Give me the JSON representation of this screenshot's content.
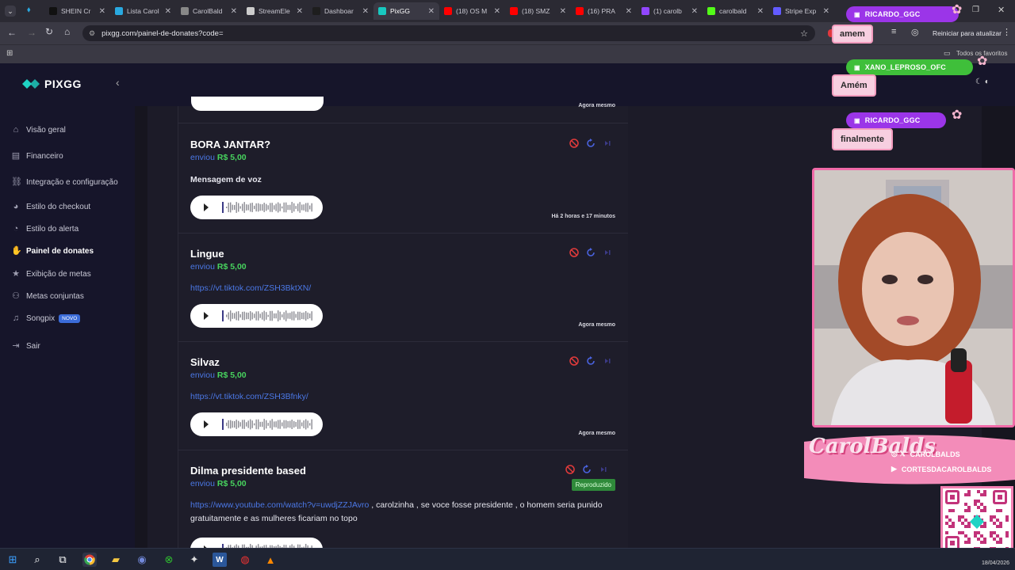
{
  "browser": {
    "tabs": [
      {
        "label": "SHEIN Cr",
        "color": "#111111"
      },
      {
        "label": "Lista Carol",
        "color": "#29a9e0"
      },
      {
        "label": "CarolBald",
        "color": "#888888"
      },
      {
        "label": "StreamEle",
        "color": "#cccccc"
      },
      {
        "label": "Dashboar",
        "color": "#1e1e1e"
      },
      {
        "label": "PixGG",
        "color": "#18c8c0"
      },
      {
        "label": "(18) OS M",
        "color": "#ff0000"
      },
      {
        "label": "(18) SMZ",
        "color": "#ff0000"
      },
      {
        "label": "(16) PRA",
        "color": "#ff0000"
      },
      {
        "label": "(1) carolb",
        "color": "#9146ff"
      },
      {
        "label": "carolbald",
        "color": "#53fc18"
      },
      {
        "label": "Stripe Exp",
        "color": "#635bff"
      }
    ],
    "url": "pixgg.com/painel-de-donates?code=",
    "reload_label": "Reiniciar para atualizar",
    "favorites_label": "Todos os favoritos"
  },
  "app": {
    "logo": "PIXGG",
    "nav": [
      {
        "label": "Visão geral",
        "icon": "home-icon"
      },
      {
        "label": "Financeiro",
        "icon": "wallet-icon"
      },
      {
        "label": "Integração e configuração",
        "icon": "link-icon"
      },
      {
        "label": "Estilo do checkout",
        "icon": "palette-icon"
      },
      {
        "label": "Estilo do alerta",
        "icon": "bell-icon"
      },
      {
        "label": "Painel de donates",
        "icon": "hand-coins-icon"
      },
      {
        "label": "Exibição de metas",
        "icon": "star-icon"
      },
      {
        "label": "Metas conjuntas",
        "icon": "people-icon"
      },
      {
        "label": "Songpix",
        "icon": "music-icon",
        "badge": "NOVO"
      },
      {
        "label": "Sair",
        "icon": "logout-icon"
      }
    ]
  },
  "donations": {
    "top_time": "Agora mesmo",
    "items": [
      {
        "name": "BORA JANTAR?",
        "sent": "enviou",
        "amount": "R$ 5,00",
        "message": "Mensagem de voz",
        "time": "Há 2 horas e 17 minutos"
      },
      {
        "name": "Lingue",
        "sent": "enviou",
        "amount": "R$ 5,00",
        "link": "https://vt.tiktok.com/ZSH3BktXN/",
        "time": "Agora mesmo"
      },
      {
        "name": "Silvaz",
        "sent": "enviou",
        "amount": "R$ 5,00",
        "link": "https://vt.tiktok.com/ZSH3Bfnky/",
        "time": "Agora mesmo"
      },
      {
        "name": "Dilma presidente based",
        "sent": "enviou",
        "amount": "R$ 5,00",
        "link": "https://www.youtube.com/watch?v=uwdjZZJAvro",
        "message": ", carolzinha , se voce fosse presidente , o homem seria punido gratuitamente e as mulheres ficariam no topo",
        "status": "Reproduzido"
      }
    ]
  },
  "overlay": {
    "chat": [
      {
        "user": "RICARDO_GGC",
        "message": "amem",
        "color": "#9b35e8"
      },
      {
        "user": "XANO_LEPROSO_OFC",
        "message": "Amém",
        "color": "#3fbf3a"
      },
      {
        "user": "RICARDO_GGC",
        "message": "finalmente",
        "color": "#9b35e8"
      }
    ],
    "brand": "CarolBalds",
    "socials": [
      "CAROLBALDS",
      "CORTESDACAROLBALDS"
    ]
  },
  "taskbar": {
    "date": "18/04/2026"
  }
}
